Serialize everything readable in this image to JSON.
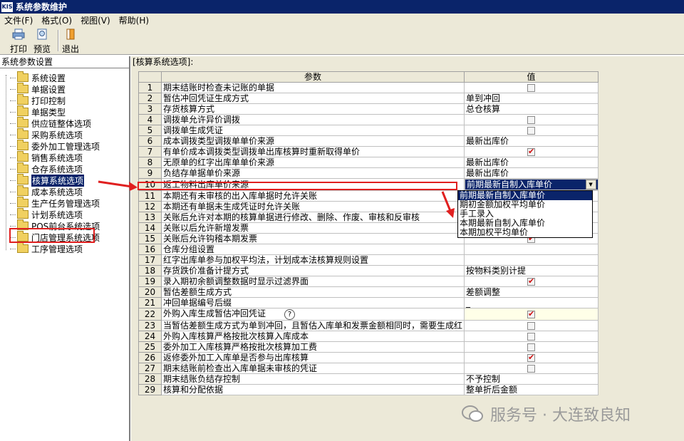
{
  "window": {
    "app_icon": "KIS",
    "title": "系统参数维护"
  },
  "menu": [
    "文件(F)",
    "格式(O)",
    "视图(V)",
    "帮助(H)"
  ],
  "toolbar": {
    "print": "打印",
    "preview": "预览",
    "exit": "退出"
  },
  "left_panel": {
    "header": "系统参数设置",
    "items": [
      "系统设置",
      "单据设置",
      "打印控制",
      "单据类型",
      "供应链整体选项",
      "采购系统选项",
      "委外加工管理选项",
      "销售系统选项",
      "仓存系统选项",
      "核算系统选项",
      "成本系统选项",
      "生产任务管理选项",
      "计划系统选项",
      "POS前台系统选项",
      "门店管理系统选项",
      "工序管理选项"
    ],
    "selected_index": 9
  },
  "right_panel": {
    "header": "[核算系统选项]:"
  },
  "grid": {
    "columns": [
      "",
      "参数",
      "值"
    ],
    "rows": [
      {
        "no": "1",
        "param": "期末结账时检查未记账的单据",
        "type": "check",
        "checked": false,
        "value": ""
      },
      {
        "no": "2",
        "param": "暂估冲回凭证生成方式",
        "type": "text",
        "checked": false,
        "value": "单到冲回"
      },
      {
        "no": "3",
        "param": "存货核算方式",
        "type": "text",
        "checked": false,
        "value": "总仓核算"
      },
      {
        "no": "4",
        "param": "调拨单允许异价调拨",
        "type": "check",
        "checked": false,
        "value": ""
      },
      {
        "no": "5",
        "param": "调拨单生成凭证",
        "type": "check",
        "checked": false,
        "value": ""
      },
      {
        "no": "6",
        "param": "成本调拨类型调拨单单价来源",
        "type": "text",
        "checked": false,
        "value": "最新出库价"
      },
      {
        "no": "7",
        "param": "有单价成本调拨类型调拨单出库核算时重新取得单价",
        "type": "check",
        "checked": true,
        "value": ""
      },
      {
        "no": "8",
        "param": "无原单的红字出库单单价来源",
        "type": "text",
        "checked": false,
        "value": "最新出库价"
      },
      {
        "no": "9",
        "param": "负结存单据单价来源",
        "type": "text",
        "checked": false,
        "value": "最新出库价"
      },
      {
        "no": "10",
        "param": "返工物料出库单价来源",
        "type": "dropdown",
        "checked": false,
        "value": "前期最新自制入库单价"
      },
      {
        "no": "11",
        "param": "本期还有未审核的出入库单据时允许关账",
        "type": "none",
        "checked": false,
        "value": ""
      },
      {
        "no": "12",
        "param": "本期还有单据未生成凭证时允许关账",
        "type": "none",
        "checked": false,
        "value": ""
      },
      {
        "no": "13",
        "param": "关账后允许对本期的核算单据进行修改、删除、作废、审核和反审核",
        "type": "none",
        "checked": false,
        "value": ""
      },
      {
        "no": "14",
        "param": "关账以后允许新增发票",
        "type": "none",
        "checked": false,
        "value": ""
      },
      {
        "no": "15",
        "param": "关账后允许钩稽本期发票",
        "type": "check",
        "checked": true,
        "value": ""
      },
      {
        "no": "16",
        "param": "仓库分组设置",
        "type": "none",
        "checked": false,
        "value": ""
      },
      {
        "no": "17",
        "param": "红字出库单参与加权平均法，计划成本法核算规则设置",
        "type": "none",
        "checked": false,
        "value": ""
      },
      {
        "no": "18",
        "param": "存货跌价准备计提方式",
        "type": "text",
        "checked": false,
        "value": "按物料类别计提"
      },
      {
        "no": "19",
        "param": "录入期初余额调整数据时显示过滤界面",
        "type": "check",
        "checked": true,
        "value": ""
      },
      {
        "no": "20",
        "param": "暂估差额生成方式",
        "type": "text",
        "checked": false,
        "value": "差额调整"
      },
      {
        "no": "21",
        "param": "冲回单据编号后缀",
        "type": "text",
        "checked": false,
        "value": "_"
      },
      {
        "no": "22",
        "param": "外购入库生成暂估冲回凭证",
        "type": "check",
        "checked": true,
        "value": "",
        "yellow": true,
        "help": "?"
      },
      {
        "no": "23",
        "param": "当暂估差额生成方式为单到冲回，且暂估入库单和发票金额相同时，需要生成红",
        "type": "check",
        "checked": false,
        "value": ""
      },
      {
        "no": "24",
        "param": "外购入库核算严格按批次核算入库成本",
        "type": "check",
        "checked": false,
        "value": ""
      },
      {
        "no": "25",
        "param": "委外加工入库核算严格按批次核算加工费",
        "type": "check",
        "checked": false,
        "value": ""
      },
      {
        "no": "26",
        "param": "返修委外加工入库单是否参与出库核算",
        "type": "check",
        "checked": true,
        "value": ""
      },
      {
        "no": "27",
        "param": "期末结账前检查出入库单据未审核的凭证",
        "type": "check",
        "checked": false,
        "value": ""
      },
      {
        "no": "28",
        "param": "期末结账负结存控制",
        "type": "text",
        "checked": false,
        "value": "不予控制"
      },
      {
        "no": "29",
        "param": "核算和分配依据",
        "type": "text",
        "checked": false,
        "value": "整单折后金额"
      }
    ]
  },
  "dropdown": {
    "options": [
      "前期最新自制入库单价",
      "期初金额加权平均单价",
      "手工录入",
      "本期最新自制入库单价",
      "本期加权平均单价"
    ],
    "highlighted_index": 0
  },
  "watermark": {
    "text": "服务号 · 大连致良知"
  },
  "colors": {
    "selection": "#0a246a",
    "annotation_red": "#e01f1f",
    "panel_bg": "#ece9d8"
  }
}
